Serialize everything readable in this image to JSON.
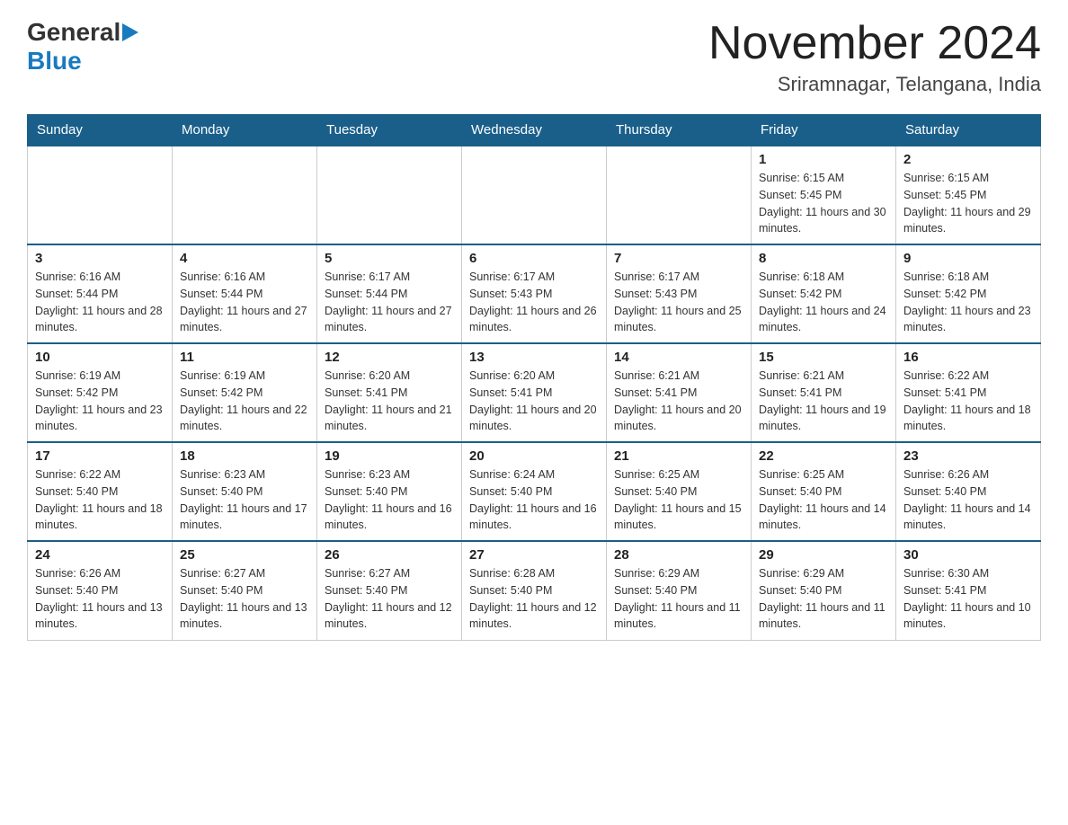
{
  "logo": {
    "general": "General",
    "blue": "Blue",
    "arrow": "▶"
  },
  "header": {
    "month_year": "November 2024",
    "location": "Sriramnagar, Telangana, India"
  },
  "weekdays": [
    "Sunday",
    "Monday",
    "Tuesday",
    "Wednesday",
    "Thursday",
    "Friday",
    "Saturday"
  ],
  "weeks": [
    [
      {
        "day": "",
        "sunrise": "",
        "sunset": "",
        "daylight": ""
      },
      {
        "day": "",
        "sunrise": "",
        "sunset": "",
        "daylight": ""
      },
      {
        "day": "",
        "sunrise": "",
        "sunset": "",
        "daylight": ""
      },
      {
        "day": "",
        "sunrise": "",
        "sunset": "",
        "daylight": ""
      },
      {
        "day": "",
        "sunrise": "",
        "sunset": "",
        "daylight": ""
      },
      {
        "day": "1",
        "sunrise": "Sunrise: 6:15 AM",
        "sunset": "Sunset: 5:45 PM",
        "daylight": "Daylight: 11 hours and 30 minutes."
      },
      {
        "day": "2",
        "sunrise": "Sunrise: 6:15 AM",
        "sunset": "Sunset: 5:45 PM",
        "daylight": "Daylight: 11 hours and 29 minutes."
      }
    ],
    [
      {
        "day": "3",
        "sunrise": "Sunrise: 6:16 AM",
        "sunset": "Sunset: 5:44 PM",
        "daylight": "Daylight: 11 hours and 28 minutes."
      },
      {
        "day": "4",
        "sunrise": "Sunrise: 6:16 AM",
        "sunset": "Sunset: 5:44 PM",
        "daylight": "Daylight: 11 hours and 27 minutes."
      },
      {
        "day": "5",
        "sunrise": "Sunrise: 6:17 AM",
        "sunset": "Sunset: 5:44 PM",
        "daylight": "Daylight: 11 hours and 27 minutes."
      },
      {
        "day": "6",
        "sunrise": "Sunrise: 6:17 AM",
        "sunset": "Sunset: 5:43 PM",
        "daylight": "Daylight: 11 hours and 26 minutes."
      },
      {
        "day": "7",
        "sunrise": "Sunrise: 6:17 AM",
        "sunset": "Sunset: 5:43 PM",
        "daylight": "Daylight: 11 hours and 25 minutes."
      },
      {
        "day": "8",
        "sunrise": "Sunrise: 6:18 AM",
        "sunset": "Sunset: 5:42 PM",
        "daylight": "Daylight: 11 hours and 24 minutes."
      },
      {
        "day": "9",
        "sunrise": "Sunrise: 6:18 AM",
        "sunset": "Sunset: 5:42 PM",
        "daylight": "Daylight: 11 hours and 23 minutes."
      }
    ],
    [
      {
        "day": "10",
        "sunrise": "Sunrise: 6:19 AM",
        "sunset": "Sunset: 5:42 PM",
        "daylight": "Daylight: 11 hours and 23 minutes."
      },
      {
        "day": "11",
        "sunrise": "Sunrise: 6:19 AM",
        "sunset": "Sunset: 5:42 PM",
        "daylight": "Daylight: 11 hours and 22 minutes."
      },
      {
        "day": "12",
        "sunrise": "Sunrise: 6:20 AM",
        "sunset": "Sunset: 5:41 PM",
        "daylight": "Daylight: 11 hours and 21 minutes."
      },
      {
        "day": "13",
        "sunrise": "Sunrise: 6:20 AM",
        "sunset": "Sunset: 5:41 PM",
        "daylight": "Daylight: 11 hours and 20 minutes."
      },
      {
        "day": "14",
        "sunrise": "Sunrise: 6:21 AM",
        "sunset": "Sunset: 5:41 PM",
        "daylight": "Daylight: 11 hours and 20 minutes."
      },
      {
        "day": "15",
        "sunrise": "Sunrise: 6:21 AM",
        "sunset": "Sunset: 5:41 PM",
        "daylight": "Daylight: 11 hours and 19 minutes."
      },
      {
        "day": "16",
        "sunrise": "Sunrise: 6:22 AM",
        "sunset": "Sunset: 5:41 PM",
        "daylight": "Daylight: 11 hours and 18 minutes."
      }
    ],
    [
      {
        "day": "17",
        "sunrise": "Sunrise: 6:22 AM",
        "sunset": "Sunset: 5:40 PM",
        "daylight": "Daylight: 11 hours and 18 minutes."
      },
      {
        "day": "18",
        "sunrise": "Sunrise: 6:23 AM",
        "sunset": "Sunset: 5:40 PM",
        "daylight": "Daylight: 11 hours and 17 minutes."
      },
      {
        "day": "19",
        "sunrise": "Sunrise: 6:23 AM",
        "sunset": "Sunset: 5:40 PM",
        "daylight": "Daylight: 11 hours and 16 minutes."
      },
      {
        "day": "20",
        "sunrise": "Sunrise: 6:24 AM",
        "sunset": "Sunset: 5:40 PM",
        "daylight": "Daylight: 11 hours and 16 minutes."
      },
      {
        "day": "21",
        "sunrise": "Sunrise: 6:25 AM",
        "sunset": "Sunset: 5:40 PM",
        "daylight": "Daylight: 11 hours and 15 minutes."
      },
      {
        "day": "22",
        "sunrise": "Sunrise: 6:25 AM",
        "sunset": "Sunset: 5:40 PM",
        "daylight": "Daylight: 11 hours and 14 minutes."
      },
      {
        "day": "23",
        "sunrise": "Sunrise: 6:26 AM",
        "sunset": "Sunset: 5:40 PM",
        "daylight": "Daylight: 11 hours and 14 minutes."
      }
    ],
    [
      {
        "day": "24",
        "sunrise": "Sunrise: 6:26 AM",
        "sunset": "Sunset: 5:40 PM",
        "daylight": "Daylight: 11 hours and 13 minutes."
      },
      {
        "day": "25",
        "sunrise": "Sunrise: 6:27 AM",
        "sunset": "Sunset: 5:40 PM",
        "daylight": "Daylight: 11 hours and 13 minutes."
      },
      {
        "day": "26",
        "sunrise": "Sunrise: 6:27 AM",
        "sunset": "Sunset: 5:40 PM",
        "daylight": "Daylight: 11 hours and 12 minutes."
      },
      {
        "day": "27",
        "sunrise": "Sunrise: 6:28 AM",
        "sunset": "Sunset: 5:40 PM",
        "daylight": "Daylight: 11 hours and 12 minutes."
      },
      {
        "day": "28",
        "sunrise": "Sunrise: 6:29 AM",
        "sunset": "Sunset: 5:40 PM",
        "daylight": "Daylight: 11 hours and 11 minutes."
      },
      {
        "day": "29",
        "sunrise": "Sunrise: 6:29 AM",
        "sunset": "Sunset: 5:40 PM",
        "daylight": "Daylight: 11 hours and 11 minutes."
      },
      {
        "day": "30",
        "sunrise": "Sunrise: 6:30 AM",
        "sunset": "Sunset: 5:41 PM",
        "daylight": "Daylight: 11 hours and 10 minutes."
      }
    ]
  ]
}
